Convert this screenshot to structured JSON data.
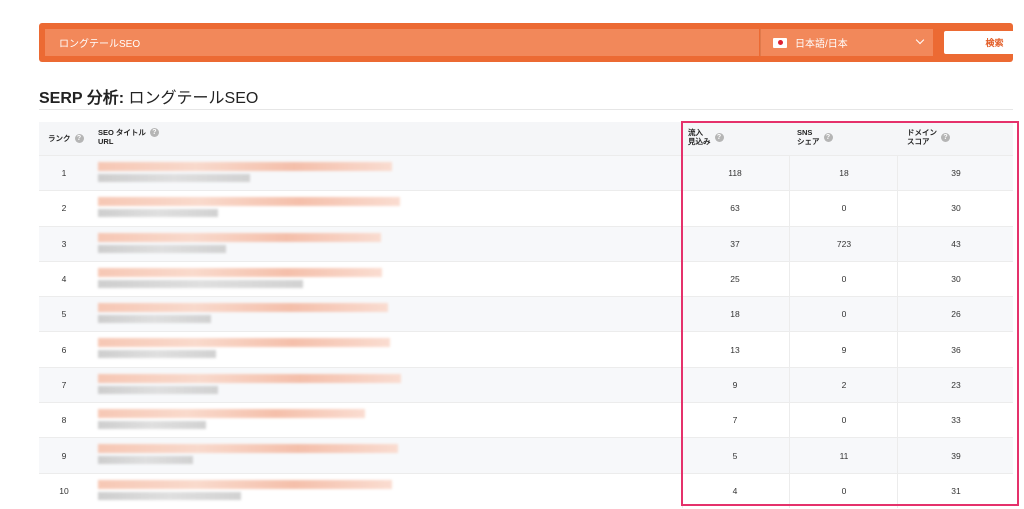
{
  "search": {
    "query": "ロングテールSEO",
    "language": "日本語/日本",
    "button_label": "検索"
  },
  "page": {
    "title_prefix": "SERP 分析:",
    "title_keyword": "ロングテールSEO"
  },
  "table": {
    "headers": {
      "rank": "ランク",
      "title": "SEO タイトル",
      "url": "URL",
      "traffic_line1": "流入",
      "traffic_line2": "見込み",
      "sns_line1": "SNS",
      "sns_line2": "シェア",
      "domain_line1": "ドメイン",
      "domain_line2": "スコア"
    },
    "rows": [
      {
        "rank": "1",
        "traffic": "118",
        "sns": "18",
        "domain": "39"
      },
      {
        "rank": "2",
        "traffic": "63",
        "sns": "0",
        "domain": "30"
      },
      {
        "rank": "3",
        "traffic": "37",
        "sns": "723",
        "domain": "43"
      },
      {
        "rank": "4",
        "traffic": "25",
        "sns": "0",
        "domain": "30"
      },
      {
        "rank": "5",
        "traffic": "18",
        "sns": "0",
        "domain": "26"
      },
      {
        "rank": "6",
        "traffic": "13",
        "sns": "9",
        "domain": "36"
      },
      {
        "rank": "7",
        "traffic": "9",
        "sns": "2",
        "domain": "23"
      },
      {
        "rank": "8",
        "traffic": "7",
        "sns": "0",
        "domain": "33"
      },
      {
        "rank": "9",
        "traffic": "5",
        "sns": "11",
        "domain": "39"
      },
      {
        "rank": "10",
        "traffic": "4",
        "sns": "0",
        "domain": "31"
      }
    ]
  },
  "colors": {
    "accent": "#ec6a33",
    "highlight": "#e5316b"
  },
  "icons": {
    "help": "help-circle-icon",
    "flag": "japan-flag-icon",
    "dropdown": "chevron-down-icon"
  }
}
